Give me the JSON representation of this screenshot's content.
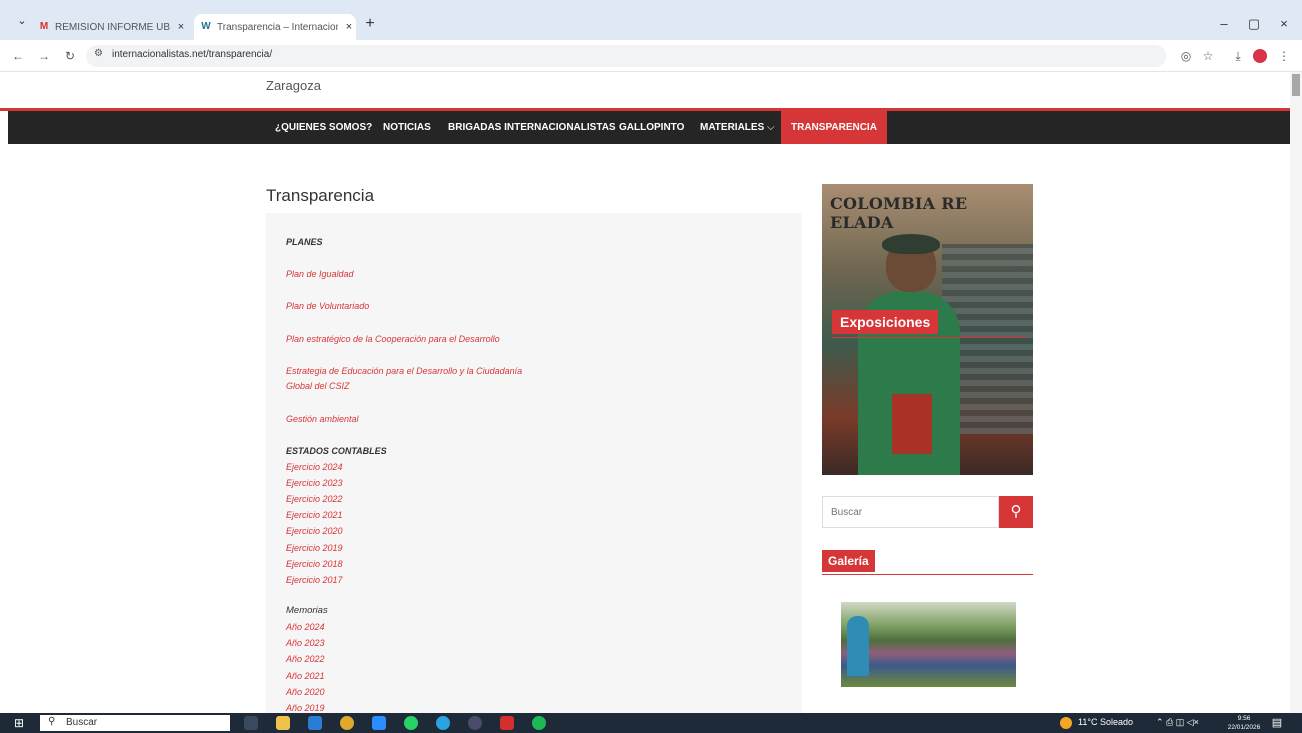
{
  "browser": {
    "tabs": [
      {
        "title": "REMISIÓN INFORME UBICACIÓ",
        "icon": "gmail-icon"
      },
      {
        "title": "Transparencia – Internacionalist",
        "icon": "wordpress-icon"
      }
    ],
    "url_host_icon": "site-info-icon",
    "url": "internacionalistas.net/transparencia/"
  },
  "site": {
    "city": "Zaragoza",
    "nav": [
      "¿QUIENES SOMOS?",
      "NOTICIAS",
      "BRIGADAS INTERNACIONALISTAS",
      "GALLOPINTO",
      "MATERIALES",
      "TRANSPARENCIA"
    ],
    "active_nav": "TRANSPARENCIA"
  },
  "page": {
    "title": "Transparencia",
    "planes_heading": "PLANES",
    "planes_links": [
      "Plan de Igualdad",
      "Plan de Voluntariado",
      "Plan estratégico de la Cooperación para el Desarrollo",
      "Estrategia de Educación para el Desarrollo y la Ciudadanía",
      "Global del CSIZ",
      "Gestión ambiental"
    ],
    "estados_heading": "ESTADOS CONTABLES",
    "estados_links": [
      "Ejercicio 2024",
      "Ejercicio 2023",
      "Ejercicio 2022",
      "Ejercicio 2021",
      "Ejercicio 2020",
      "Ejercicio 2019",
      "Ejercicio 2018",
      "Ejercicio 2017"
    ],
    "memorias_heading": "Memorias",
    "memorias_links": [
      "Año 2024",
      "Año 2023",
      "Año 2022",
      "Año 2021",
      "Año 2020",
      "Año 2019"
    ]
  },
  "sidebar": {
    "poster_title": "COLOMBIA RE ELADA",
    "poster_label": "Exposiciones",
    "search_placeholder": "Buscar",
    "gallery_label": "Galería"
  },
  "taskbar": {
    "search_label": "Buscar",
    "weather": "11°C Soleado",
    "time": "9:56",
    "date": "22/01/2026"
  },
  "colors": {
    "accent": "#d63638",
    "navbar": "#252525"
  }
}
